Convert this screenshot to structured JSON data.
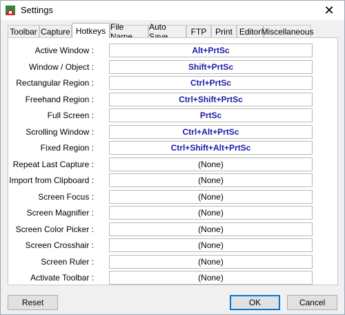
{
  "window": {
    "title": "Settings",
    "close_glyph": "✕"
  },
  "tabs": [
    {
      "label": "Toolbar"
    },
    {
      "label": "Capture"
    },
    {
      "label": "Hotkeys"
    },
    {
      "label": "File Name"
    },
    {
      "label": "Auto Save"
    },
    {
      "label": "FTP"
    },
    {
      "label": "Print"
    },
    {
      "label": "Editor"
    },
    {
      "label": "Miscellaneous"
    }
  ],
  "active_tab": "Hotkeys",
  "hotkeys": [
    {
      "label": "Active Window :",
      "value": "Alt+PrtSc"
    },
    {
      "label": "Window / Object :",
      "value": "Shift+PrtSc"
    },
    {
      "label": "Rectangular Region :",
      "value": "Ctrl+PrtSc"
    },
    {
      "label": "Freehand Region :",
      "value": "Ctrl+Shift+PrtSc"
    },
    {
      "label": "Full Screen :",
      "value": "PrtSc"
    },
    {
      "label": "Scrolling Window :",
      "value": "Ctrl+Alt+PrtSc"
    },
    {
      "label": "Fixed Region :",
      "value": "Ctrl+Shift+Alt+PrtSc"
    },
    {
      "label": "Repeat Last Capture :",
      "value": "(None)"
    },
    {
      "label": "Import from Clipboard :",
      "value": "(None)"
    },
    {
      "label": "Screen Focus :",
      "value": "(None)"
    },
    {
      "label": "Screen Magnifier :",
      "value": "(None)"
    },
    {
      "label": "Screen Color Picker :",
      "value": "(None)"
    },
    {
      "label": "Screen Crosshair :",
      "value": "(None)"
    },
    {
      "label": "Screen Ruler :",
      "value": "(None)"
    },
    {
      "label": "Activate Toolbar :",
      "value": "(None)"
    }
  ],
  "buttons": {
    "reset": "Reset",
    "ok": "OK",
    "cancel": "Cancel"
  },
  "colors": {
    "assigned_hotkey": "#1a1aa8",
    "default_button_border": "#0078d7"
  }
}
